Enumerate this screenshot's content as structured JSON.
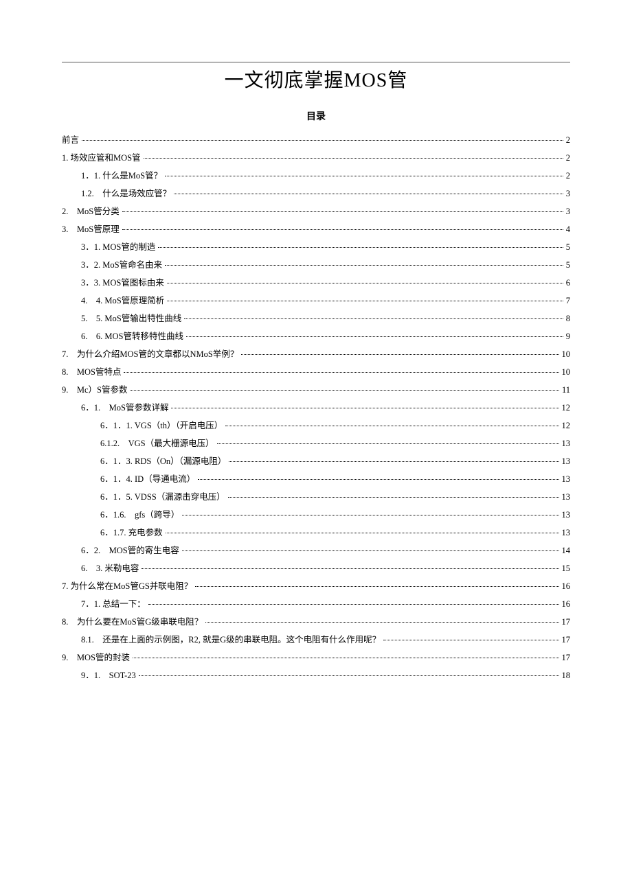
{
  "title": "一文彻底掌握MOS管",
  "toc_heading": "目录",
  "toc": [
    {
      "label": "前言",
      "page": "2",
      "indent": 0
    },
    {
      "label": "1. 场效应管和MOS管",
      "page": "2",
      "indent": 0
    },
    {
      "label": "1．1. 什么是MoS管？",
      "page": "2",
      "indent": 1
    },
    {
      "label": "1.2.　什么是场效应管？",
      "page": "3",
      "indent": 1
    },
    {
      "label": "2.　MoS管分类",
      "page": "3",
      "indent": 0
    },
    {
      "label": "3.　MoS管原理",
      "page": "4",
      "indent": 0
    },
    {
      "label": "3．1. MOS管的制造",
      "page": "5",
      "indent": 1
    },
    {
      "label": "3．2. MoS管命名由来",
      "page": "5",
      "indent": 1
    },
    {
      "label": "3．3. MOS管图标由来",
      "page": "6",
      "indent": 1
    },
    {
      "label": "4.　4. MoS管原理简析",
      "page": "7",
      "indent": 1
    },
    {
      "label": "5.　5. MoS管输出特性曲线",
      "page": "8",
      "indent": 1
    },
    {
      "label": "6.　6. MOS管转移特性曲线",
      "page": "9",
      "indent": 1
    },
    {
      "label": "7.　为什么介绍MOS管的文章都以NMoS举例？",
      "page": "10",
      "indent": 0
    },
    {
      "label": "8.　MOS管特点",
      "page": "10",
      "indent": 0
    },
    {
      "label": "9.　Mc）S管参数",
      "page": "11",
      "indent": 0
    },
    {
      "label": "6．1.　MoS管参数详解",
      "page": "12",
      "indent": 1
    },
    {
      "label": "6．1．1. VGS（th）（开启电压）",
      "page": "12",
      "indent": 2
    },
    {
      "label": "6.1.2.　VGS（最大栅源电压）",
      "page": "13",
      "indent": 2
    },
    {
      "label": "6．1．3. RDS（On）（漏源电阻）",
      "page": "13",
      "indent": 2
    },
    {
      "label": "6．1．4. ID（导通电流）",
      "page": "13",
      "indent": 2
    },
    {
      "label": "6．1．5. VDSS（漏源击穿电压）",
      "page": "13",
      "indent": 2
    },
    {
      "label": "6．1.6.　gfs（跨导）",
      "page": "13",
      "indent": 2
    },
    {
      "label": "6．1.7. 充电参数",
      "page": "13",
      "indent": 2
    },
    {
      "label": "6．2.　MOS管的寄生电容",
      "page": "14",
      "indent": 1
    },
    {
      "label": "6.　3. 米勒电容",
      "page": "15",
      "indent": 1
    },
    {
      "label": "7. 为什么常在MoS管GS并联电阻？",
      "page": "16",
      "indent": 0
    },
    {
      "label": "7．1. 总结一下：",
      "page": "16",
      "indent": 1
    },
    {
      "label": "8.　为什么要在MoS管G级串联电阻？",
      "page": "17",
      "indent": 0
    },
    {
      "label": "8.1.　还是在上面的示例图，R2, 就是G级的串联电阻。这个电阻有什么作用呢？",
      "page": "17",
      "indent": 1
    },
    {
      "label": "9.　MOS管的封装",
      "page": "17",
      "indent": 0
    },
    {
      "label": "9．1.　SOT-23",
      "page": "18",
      "indent": 1
    }
  ]
}
